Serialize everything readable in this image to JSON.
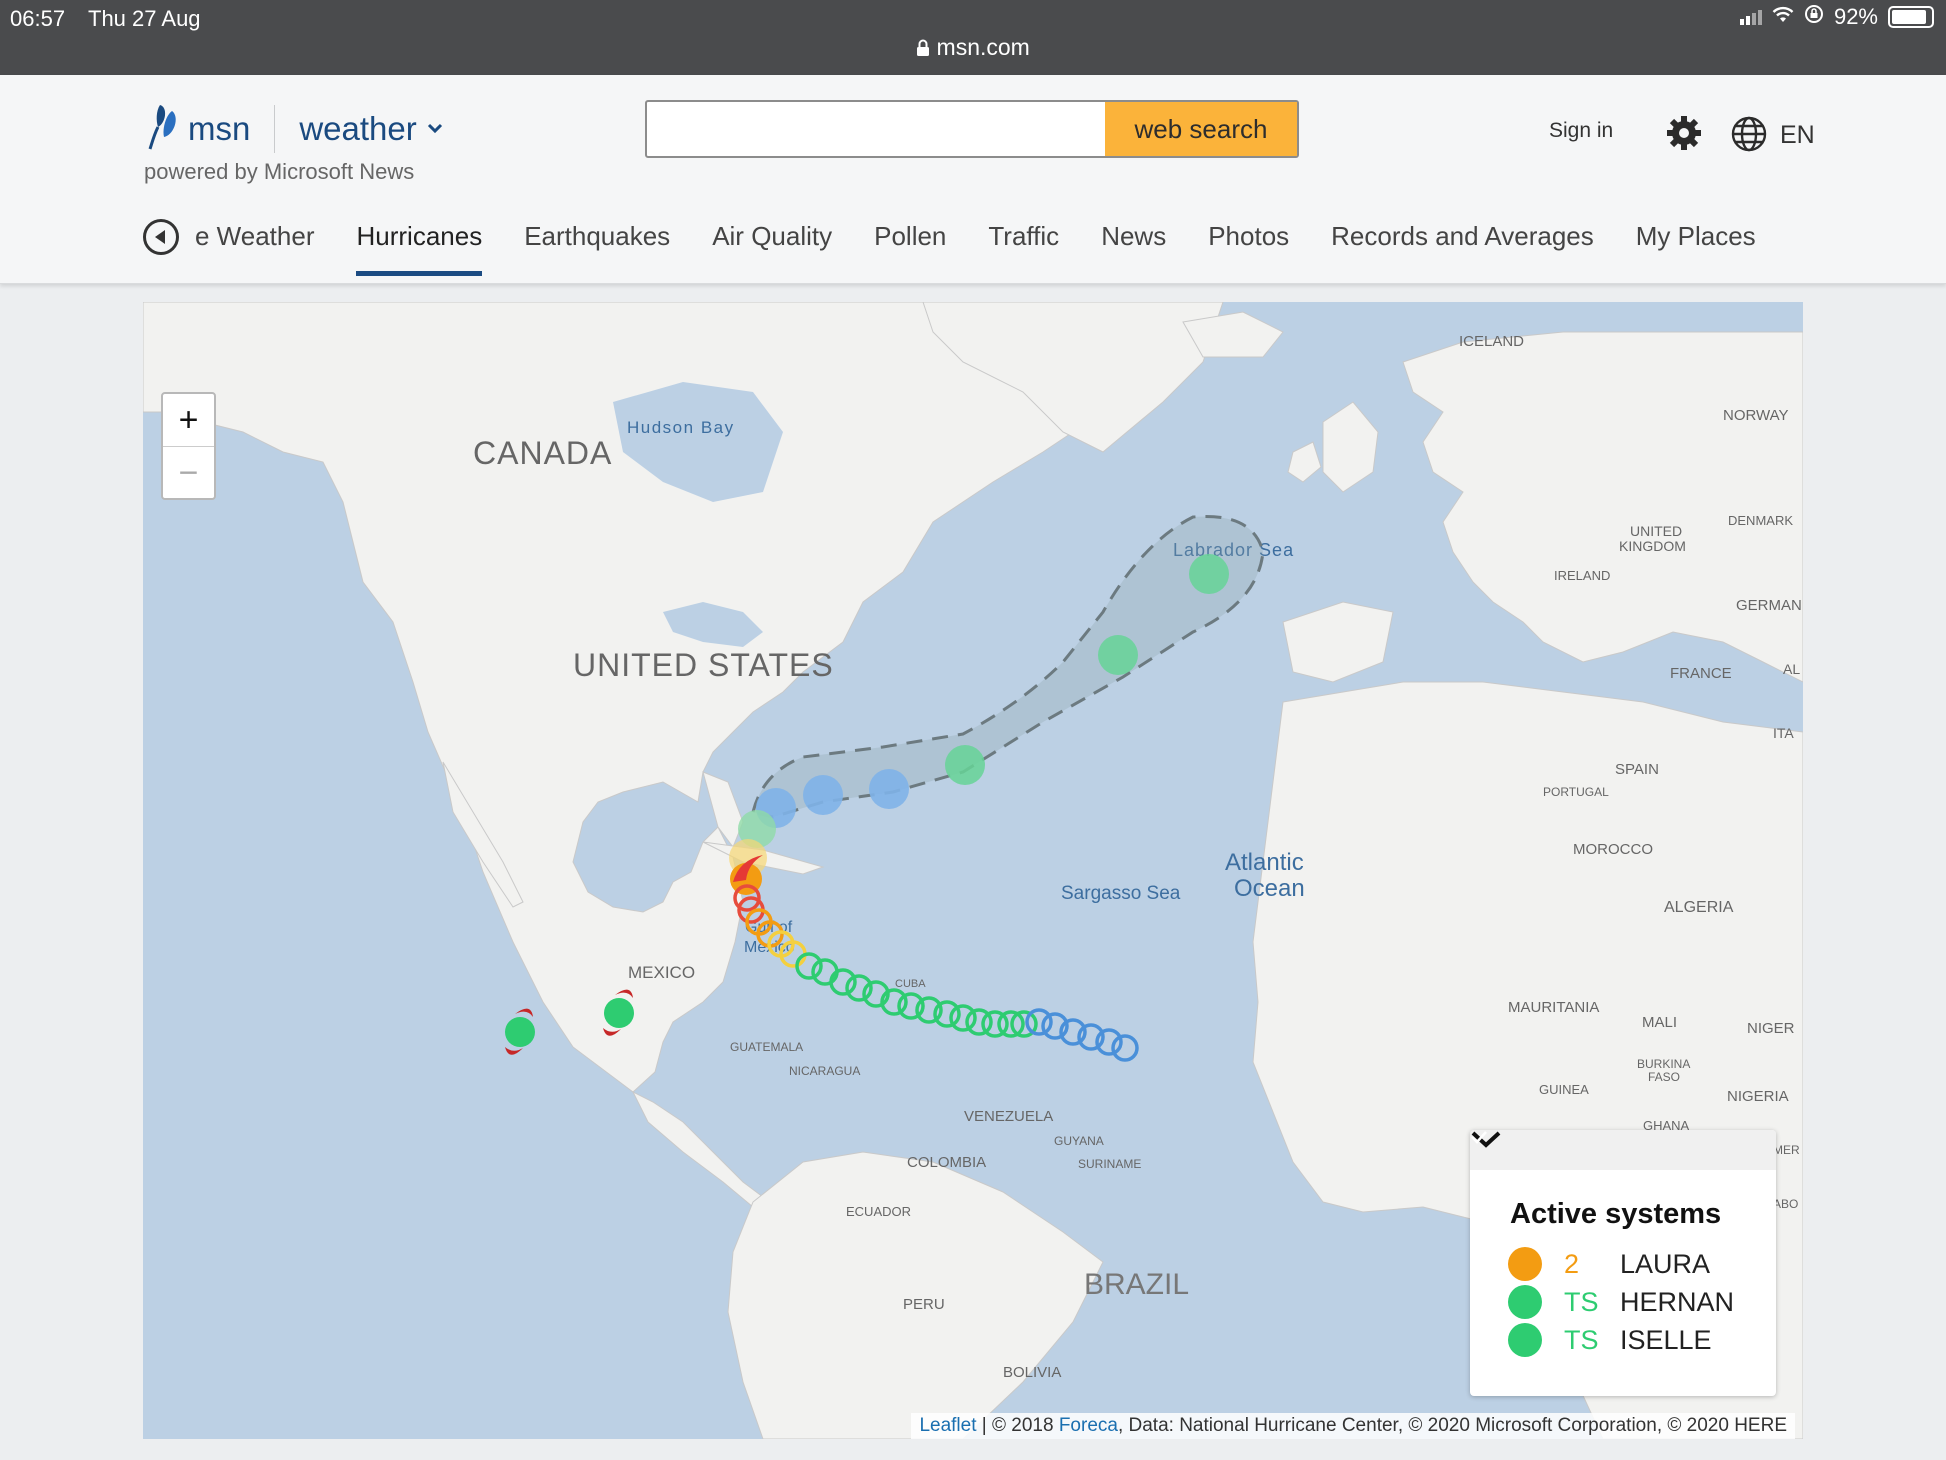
{
  "status_bar": {
    "time": "06:57",
    "date": "Thu 27 Aug",
    "url": "msn.com",
    "battery": "92%"
  },
  "header": {
    "brand": "msn",
    "section": "weather",
    "powered_by": "powered by Microsoft News",
    "search_placeholder": "",
    "search_button": "web search",
    "sign_in": "Sign in",
    "language": "EN",
    "icons": [
      "msn-butterfly-icon",
      "chevron-down-icon",
      "gear-icon",
      "globe-icon",
      "back-icon",
      "lock-icon"
    ]
  },
  "nav": {
    "items": [
      "e Weather",
      "Hurricanes",
      "Earthquakes",
      "Air Quality",
      "Pollen",
      "Traffic",
      "News",
      "Photos",
      "Records and Averages",
      "My Places"
    ],
    "active": "Hurricanes"
  },
  "map": {
    "zoom_in": "+",
    "zoom_out": "−",
    "labels": {
      "canada": "CANADA",
      "united_states": "UNITED STATES",
      "mexico": "MEXICO",
      "brazil": "BRAZIL",
      "hudson_bay": "Hudson Bay",
      "labrador_sea": "Labrador Sea",
      "atlantic_1": "Atlantic",
      "atlantic_2": "Ocean",
      "sargasso_sea": "Sargasso Sea",
      "gulf_1": "Gulf of",
      "gulf_2": "Mexico",
      "iceland": "ICELAND",
      "norway": "NORWAY",
      "united_kingdom_1": "UNITED",
      "united_kingdom_2": "KINGDOM",
      "ireland": "IRELAND",
      "denmark": "DENMARK",
      "germany": "GERMAN",
      "france": "FRANCE",
      "spain": "SPAIN",
      "portugal": "PORTUGAL",
      "italy": "ITA",
      "al": "AL",
      "morocco": "MOROCCO",
      "algeria": "ALGERIA",
      "mauritania": "MAURITANIA",
      "mali": "MALI",
      "niger": "NIGER",
      "burkina_1": "BURKINA",
      "burkina_2": "FASO",
      "guinea": "GUINEA",
      "nigeria": "NIGERIA",
      "ghana": "GHANA",
      "cameroon": "MER",
      "gabon": "ABO",
      "guatemala": "GUATEMALA",
      "nicaragua": "NICARAGUA",
      "venezuela": "VENEZUELA",
      "guyana": "GUYANA",
      "suriname": "SURINAME",
      "colombia": "COLOMBIA",
      "ecuador": "ECUADOR",
      "peru": "PERU",
      "bolivia": "BOLIVIA",
      "cuba": "CUBA"
    },
    "attribution": {
      "leaflet": "Leaflet",
      "sep": " | © 2018 ",
      "foreca": "Foreca",
      "rest": ", Data: National Hurricane Center, © 2020 Microsoft Corporation, © 2020 HERE"
    },
    "colors": {
      "water": "#bcd0e4",
      "land": "#f2f2f0",
      "td": "#4a90d9",
      "ts": "#2ecc71",
      "cat1": "#f4d03f",
      "cat2": "#f39c12",
      "cat3": "#e74c3c"
    }
  },
  "legend": {
    "title": "Active systems",
    "systems": [
      {
        "category": "2",
        "name": "LAURA",
        "color": "#f39c12",
        "cat_color": "#f39c12",
        "icon": "check-icon"
      },
      {
        "category": "TS",
        "name": "HERNAN",
        "color": "#2ecc71",
        "cat_color": "#2ecc71",
        "icon": ""
      },
      {
        "category": "TS",
        "name": "ISELLE",
        "color": "#2ecc71",
        "cat_color": "#2ecc71",
        "icon": ""
      }
    ]
  }
}
